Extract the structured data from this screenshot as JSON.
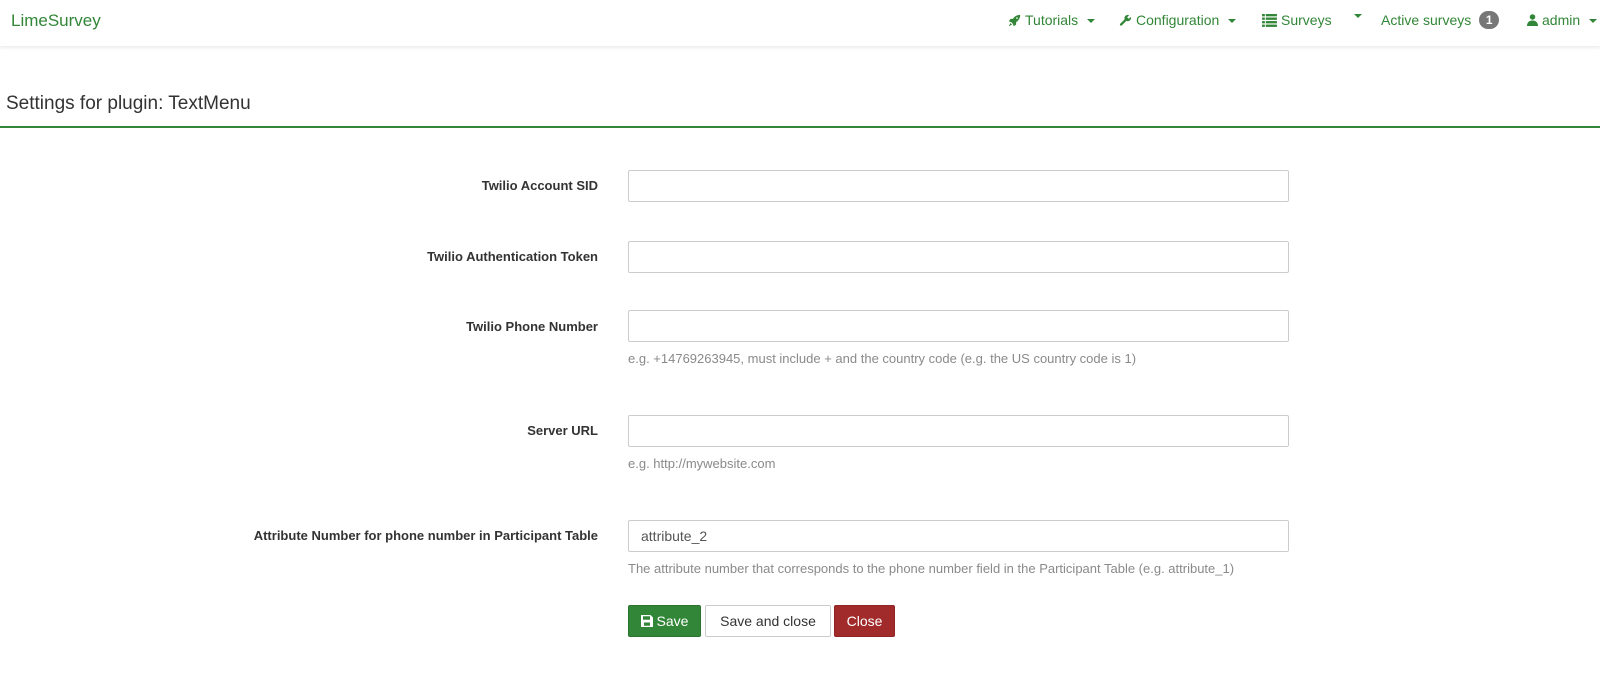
{
  "navbar": {
    "brand": "LimeSurvey",
    "tutorials": {
      "label": "Tutorials",
      "icon": "rocket-icon"
    },
    "configuration": {
      "label": "Configuration",
      "icon": "wrench-icon"
    },
    "surveys": {
      "label": "Surveys",
      "icon": "list-icon"
    },
    "active_surveys": {
      "label": "Active surveys",
      "count": "1"
    },
    "user": {
      "label": "admin",
      "icon": "user-icon"
    }
  },
  "page": {
    "title": "Settings for plugin: TextMenu"
  },
  "form": {
    "account_sid": {
      "label": "Twilio Account SID",
      "value": ""
    },
    "auth_token": {
      "label": "Twilio Authentication Token",
      "value": ""
    },
    "phone_number": {
      "label": "Twilio Phone Number",
      "value": "",
      "help": "e.g. +14769263945, must include + and the country code (e.g. the US country code is 1)"
    },
    "server_url": {
      "label": "Server URL",
      "value": "",
      "help": "e.g. http://mywebsite.com"
    },
    "attribute_number": {
      "label": "Attribute Number for phone number in Participant Table",
      "value": "attribute_2",
      "help": "The attribute number that corresponds to the phone number field in the Participant Table (e.g. attribute_1)"
    }
  },
  "actions": {
    "save": "Save",
    "save_and_close": "Save and close",
    "close": "Close"
  },
  "colors": {
    "brand_green": "#328637",
    "danger_red": "#a12b2b",
    "badge_gray": "#777777"
  }
}
